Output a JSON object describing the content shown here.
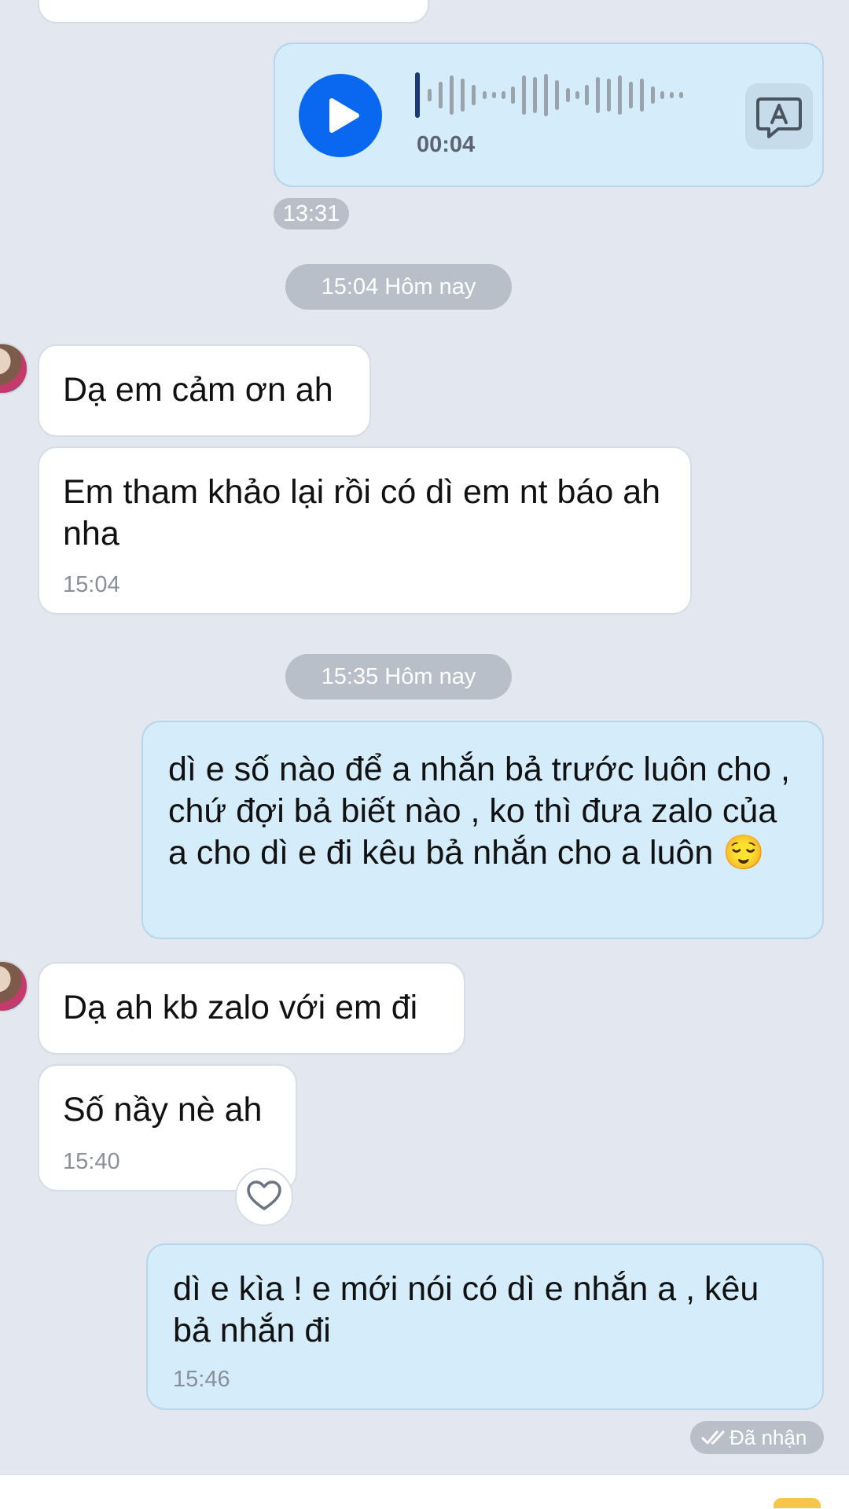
{
  "voice_message": {
    "duration": "00:04",
    "time": "13:31",
    "transcribe_icon": "speech-to-text-icon"
  },
  "separators": [
    {
      "label": "15:04 Hôm nay"
    },
    {
      "label": "15:35 Hôm nay"
    }
  ],
  "messages": [
    {
      "text": "Dạ em cảm ơn ah"
    },
    {
      "text": "Em tham khảo lại rồi có dì em nt báo ah nha",
      "time": "15:04"
    },
    {
      "text": "dì e số nào để a nhắn bả trước luôn cho , chứ đợi bả biết nào , ko thì đưa zalo của a cho dì e đi kêu bả nhắn cho a luôn",
      "emoji": "😌"
    },
    {
      "text": "Dạ ah kb zalo với em đi"
    },
    {
      "text": "Số nầy nè ah",
      "time": "15:40"
    },
    {
      "text": "dì e kìa ! e mới nói có dì e nhắn a , kêu bả nhắn đi",
      "time": "15:46"
    }
  ],
  "status": {
    "label": "Đã nhận"
  },
  "colors": {
    "background": "#e2e7f0",
    "outgoing_bubble": "#d5ecfb",
    "incoming_bubble": "#ffffff",
    "play_button": "#0a68f0"
  }
}
